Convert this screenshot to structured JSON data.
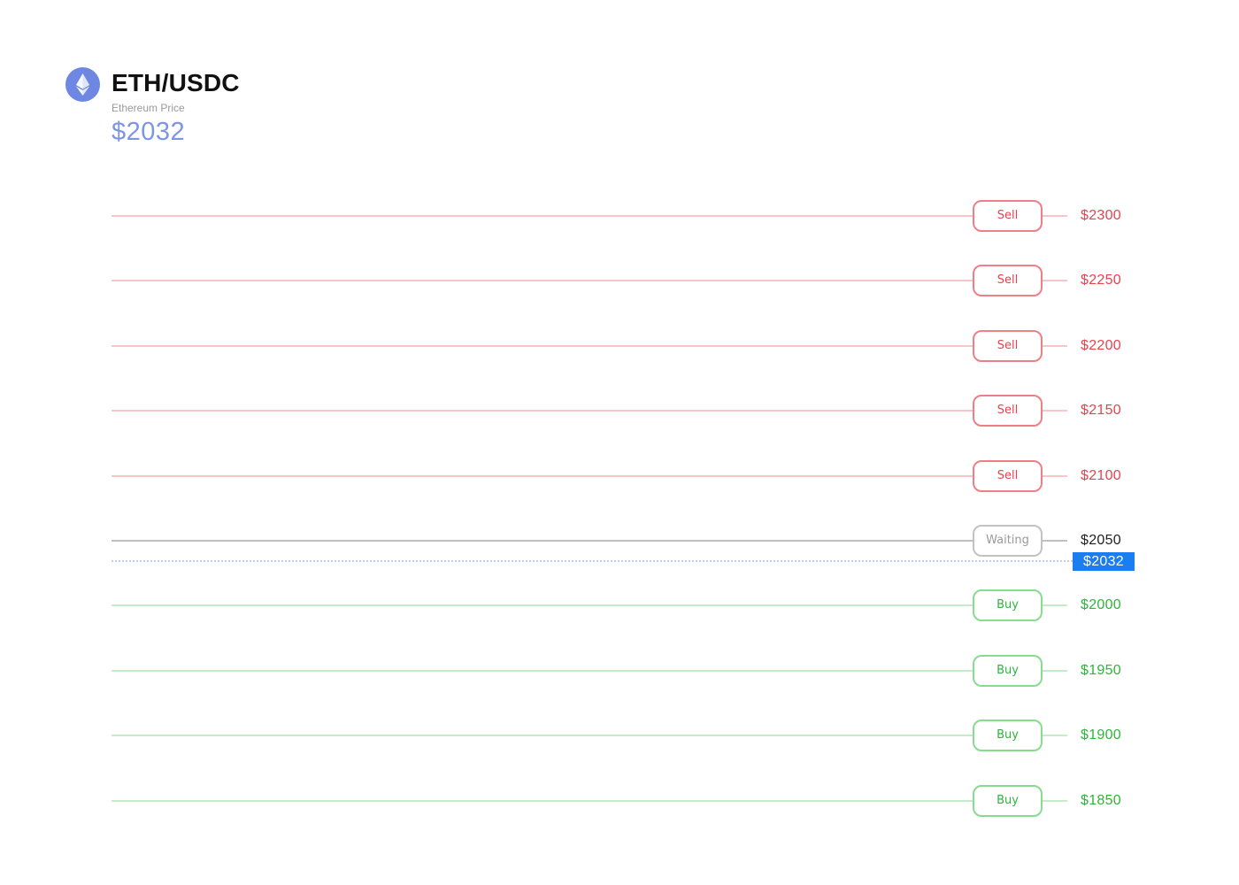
{
  "header": {
    "logo_icon": "ethereum-icon",
    "pair": "ETH/USDC",
    "subtitle": "Ethereum Price",
    "price": "$2032"
  },
  "current_price_marker": {
    "label": "$2032",
    "value": 2032,
    "color": "#1a7ef0"
  },
  "colors": {
    "sell": "#e8424d",
    "buy": "#2db43b",
    "waiting": "#9a9a9a",
    "accent": "#6d87e2"
  },
  "levels": [
    {
      "action": "Sell",
      "price": "$2300",
      "kind": "sell"
    },
    {
      "action": "Sell",
      "price": "$2250",
      "kind": "sell"
    },
    {
      "action": "Sell",
      "price": "$2200",
      "kind": "sell"
    },
    {
      "action": "Sell",
      "price": "$2150",
      "kind": "sell"
    },
    {
      "action": "Sell",
      "price": "$2100",
      "kind": "sell"
    },
    {
      "action": "Waiting",
      "price": "$2050",
      "kind": "wait"
    },
    {
      "action": "Buy",
      "price": "$2000",
      "kind": "buy"
    },
    {
      "action": "Buy",
      "price": "$1950",
      "kind": "buy"
    },
    {
      "action": "Buy",
      "price": "$1900",
      "kind": "buy"
    },
    {
      "action": "Buy",
      "price": "$1850",
      "kind": "buy"
    }
  ]
}
